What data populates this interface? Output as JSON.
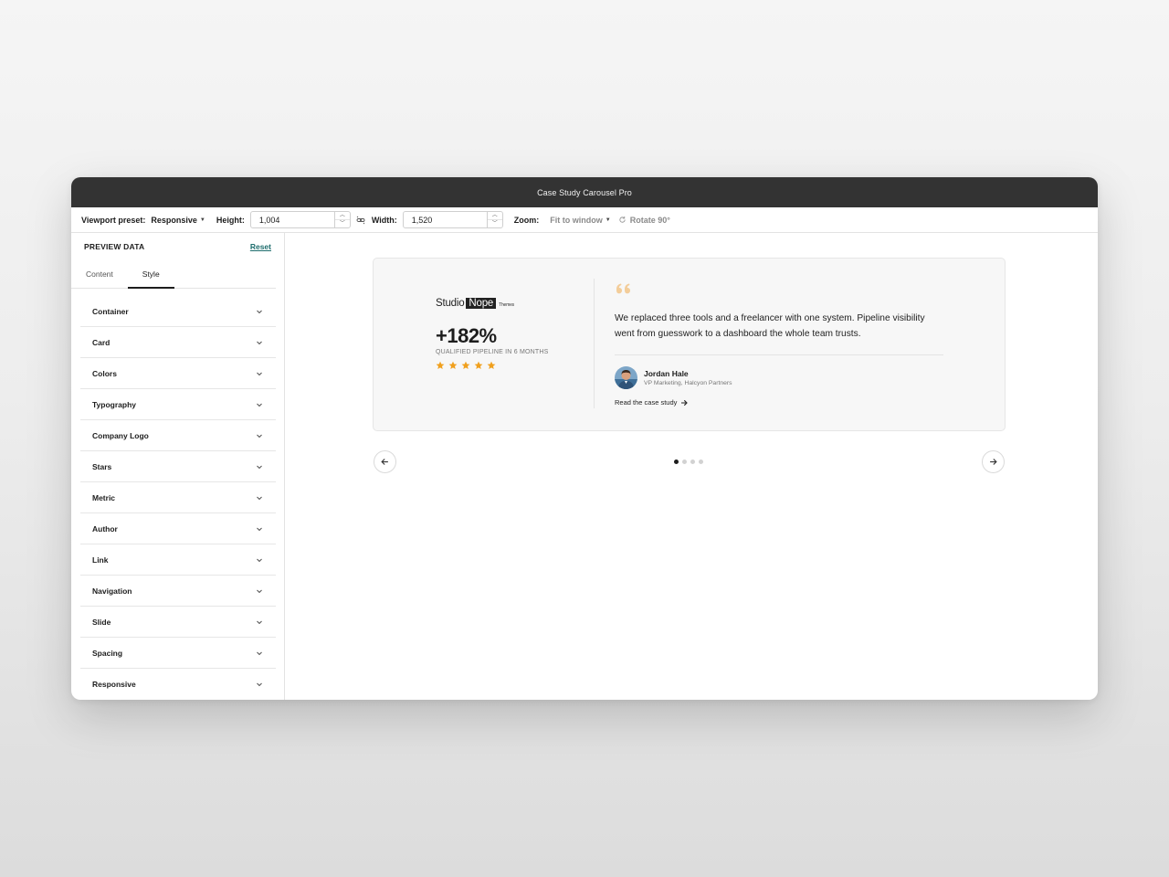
{
  "window": {
    "title": "Case Study Carousel Pro"
  },
  "toolbar": {
    "viewport_label": "Viewport preset:",
    "viewport_value": "Responsive",
    "height_label": "Height:",
    "height_value": "1,004",
    "width_label": "Width:",
    "width_value": "1,520",
    "zoom_label": "Zoom:",
    "zoom_value": "Fit to window",
    "rotate_label": "Rotate 90°"
  },
  "sidebar": {
    "title": "PREVIEW DATA",
    "reset_label": "Reset",
    "tabs": [
      {
        "label": "Content",
        "active": false
      },
      {
        "label": "Style",
        "active": true
      }
    ],
    "sections": [
      "Container",
      "Card",
      "Colors",
      "Typography",
      "Company Logo",
      "Stars",
      "Metric",
      "Author",
      "Link",
      "Navigation",
      "Slide",
      "Spacing",
      "Responsive"
    ]
  },
  "card": {
    "logo": {
      "word1": "Studio",
      "word2": "Nope",
      "word3": "Themes"
    },
    "metric_value": "+182%",
    "metric_label": "QUALIFIED PIPELINE IN 6 MONTHS",
    "rating": 5,
    "star_color": "#f0a01e",
    "quote_color": "#f3cd9a",
    "quote": "We replaced three tools and a freelancer with one system. Pipeline visibility went from guesswork to a dashboard the whole team trusts.",
    "author_name": "Jordan Hale",
    "author_role": "VP Marketing, Halcyon Partners",
    "link_label": "Read the case study"
  },
  "carousel": {
    "slide_count": 4,
    "active_index": 0
  }
}
